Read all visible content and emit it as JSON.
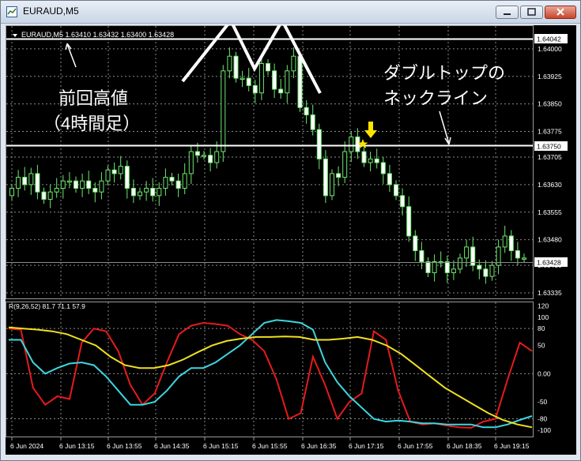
{
  "window": {
    "title": "EURAUD,M5"
  },
  "main_chart": {
    "header": "EURAUD,M5  1.63410 1.63432 1.63400 1.63428",
    "y_ticks": [
      "1.64000",
      "1.63925",
      "1.63850",
      "1.63775",
      "1.63705",
      "1.63630",
      "1.63555",
      "1.63480",
      "1.63410",
      "1.63335"
    ],
    "y_tick_values": [
      1.64,
      1.63925,
      1.6385,
      1.63775,
      1.63705,
      1.6363,
      1.63555,
      1.6348,
      1.6341,
      1.63335
    ],
    "price_labels": {
      "top": "1.64042",
      "neckline": "1.63750",
      "current": "1.63428"
    }
  },
  "annotations": {
    "prev_high_line1": "前回高値",
    "prev_high_line2": "（4時間足）",
    "neck_line1": "ダブルトップの",
    "neck_line2": "ネックライン"
  },
  "indicator": {
    "header": "R(9,26,52) 81.7 71.1 57.9",
    "y_ticks": [
      "120",
      "100",
      "80",
      "50",
      "0.00",
      "-50",
      "-80",
      "-100"
    ]
  },
  "x_axis": {
    "labels": [
      "6 Jun 2024",
      "6 Jun 13:15",
      "6 Jun 13:55",
      "6 Jun 14:35",
      "6 Jun 15:15",
      "6 Jun 15:55",
      "6 Jun 16:35",
      "6 Jun 17:15",
      "6 Jun 17:55",
      "6 Jun 18:35",
      "6 Jun 19:15"
    ]
  },
  "colors": {
    "background": "#000000",
    "grid": "#9a9a9a",
    "candles": "#6ee86e",
    "rci_fast": "#e51b1b",
    "rci_mid": "#3dd6e0",
    "rci_slow": "#f0e020",
    "highlight": "#ffe400"
  },
  "chart_data": {
    "type": "line",
    "panels": [
      {
        "name": "price",
        "x": [
          "12:35",
          "12:40",
          "12:45",
          "12:50",
          "12:55",
          "13:00",
          "13:05",
          "13:10",
          "13:15",
          "13:20",
          "13:25",
          "13:30",
          "13:35",
          "13:40",
          "13:45",
          "13:50",
          "13:55",
          "14:00",
          "14:05",
          "14:10",
          "14:15",
          "14:20",
          "14:25",
          "14:30",
          "14:35",
          "14:40",
          "14:45",
          "14:50",
          "14:55",
          "15:00",
          "15:05",
          "15:10",
          "15:15",
          "15:20",
          "15:25",
          "15:30",
          "15:35",
          "15:40",
          "15:45",
          "15:50",
          "15:55",
          "16:00",
          "16:05",
          "16:10",
          "16:15",
          "16:20",
          "16:25",
          "16:30",
          "16:35",
          "16:40",
          "16:45",
          "16:50",
          "16:55",
          "17:00",
          "17:05",
          "17:10",
          "17:15",
          "17:20",
          "17:25",
          "17:30",
          "17:35",
          "17:40",
          "17:45",
          "17:50",
          "17:55",
          "18:00",
          "18:05",
          "18:10",
          "18:15",
          "18:20",
          "18:25",
          "18:30",
          "18:35",
          "18:40",
          "18:45",
          "18:50",
          "18:55",
          "19:00",
          "19:05",
          "19:10",
          "19:15"
        ],
        "close": [
          1.6362,
          1.6365,
          1.6363,
          1.6366,
          1.6361,
          1.6359,
          1.6361,
          1.6362,
          1.6364,
          1.6364,
          1.6362,
          1.6364,
          1.6362,
          1.6361,
          1.6364,
          1.6367,
          1.6366,
          1.6368,
          1.6362,
          1.636,
          1.6361,
          1.6362,
          1.636,
          1.6362,
          1.6365,
          1.6364,
          1.6362,
          1.6366,
          1.6372,
          1.6371,
          1.6371,
          1.6369,
          1.6372,
          1.6394,
          1.6398,
          1.6392,
          1.6392,
          1.639,
          1.6388,
          1.6396,
          1.6394,
          1.6389,
          1.6388,
          1.6394,
          1.6398,
          1.6384,
          1.6382,
          1.6378,
          1.637,
          1.636,
          1.6366,
          1.6365,
          1.6372,
          1.6376,
          1.6372,
          1.6369,
          1.637,
          1.6369,
          1.6366,
          1.6363,
          1.636,
          1.6357,
          1.6349,
          1.6345,
          1.6342,
          1.6339,
          1.6342,
          1.6342,
          1.6339,
          1.634,
          1.6343,
          1.6346,
          1.6341,
          1.634,
          1.6338,
          1.6341,
          1.6346,
          1.6349,
          1.6345,
          1.6343,
          1.6343
        ],
        "ylim": [
          1.6332,
          1.6406
        ],
        "ref_lines": [
          1.64042,
          1.6375,
          1.63428
        ]
      },
      {
        "name": "RCI(9,26,52)",
        "ylim": [
          -110,
          125
        ],
        "series": [
          {
            "name": "R",
            "values": [
              80,
              78,
              -25,
              -55,
              -40,
              -45,
              55,
              80,
              75,
              40,
              -20,
              -55,
              -35,
              20,
              70,
              85,
              90,
              88,
              85,
              70,
              60,
              40,
              -10,
              -80,
              -70,
              30,
              -20,
              -80,
              -50,
              -35,
              75,
              60,
              -30,
              -85,
              -90,
              -88,
              -92,
              -95,
              -96,
              -85,
              -80,
              -10,
              55,
              40
            ]
          },
          {
            "name": "R",
            "values": [
              60,
              60,
              20,
              0,
              10,
              18,
              20,
              15,
              -5,
              -30,
              -55,
              -55,
              -50,
              -30,
              -5,
              10,
              10,
              20,
              35,
              50,
              70,
              90,
              95,
              93,
              90,
              78,
              20,
              -15,
              -40,
              -60,
              -80,
              -85,
              -83,
              -85,
              -88,
              -88,
              -90,
              -90,
              -90,
              -95,
              -95,
              -90,
              -82,
              -75
            ]
          },
          {
            "name": "R",
            "values": [
              82,
              80,
              78,
              75,
              70,
              60,
              50,
              30,
              15,
              10,
              10,
              15,
              25,
              38,
              50,
              58,
              62,
              65,
              65,
              66,
              65,
              60,
              60,
              62,
              65,
              60,
              50,
              35,
              15,
              -5,
              -25,
              -40,
              -55,
              -70,
              -82,
              -90,
              -95
            ]
          }
        ]
      }
    ]
  }
}
